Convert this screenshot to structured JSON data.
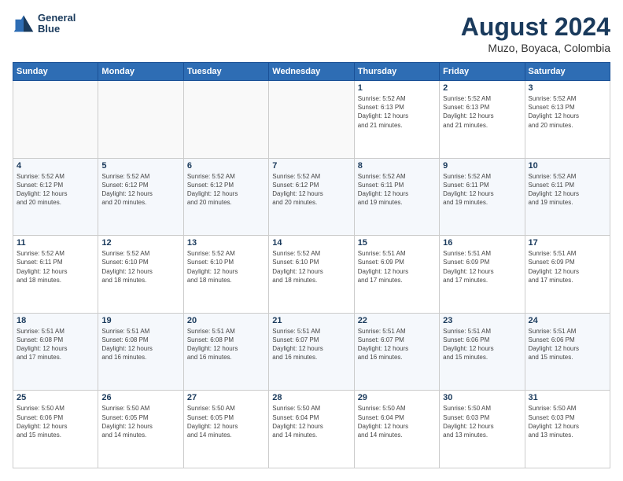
{
  "logo": {
    "line1": "General",
    "line2": "Blue"
  },
  "title": "August 2024",
  "subtitle": "Muzo, Boyaca, Colombia",
  "days_of_week": [
    "Sunday",
    "Monday",
    "Tuesday",
    "Wednesday",
    "Thursday",
    "Friday",
    "Saturday"
  ],
  "weeks": [
    [
      {
        "day": "",
        "info": ""
      },
      {
        "day": "",
        "info": ""
      },
      {
        "day": "",
        "info": ""
      },
      {
        "day": "",
        "info": ""
      },
      {
        "day": "1",
        "info": "Sunrise: 5:52 AM\nSunset: 6:13 PM\nDaylight: 12 hours\nand 21 minutes."
      },
      {
        "day": "2",
        "info": "Sunrise: 5:52 AM\nSunset: 6:13 PM\nDaylight: 12 hours\nand 21 minutes."
      },
      {
        "day": "3",
        "info": "Sunrise: 5:52 AM\nSunset: 6:13 PM\nDaylight: 12 hours\nand 20 minutes."
      }
    ],
    [
      {
        "day": "4",
        "info": "Sunrise: 5:52 AM\nSunset: 6:12 PM\nDaylight: 12 hours\nand 20 minutes."
      },
      {
        "day": "5",
        "info": "Sunrise: 5:52 AM\nSunset: 6:12 PM\nDaylight: 12 hours\nand 20 minutes."
      },
      {
        "day": "6",
        "info": "Sunrise: 5:52 AM\nSunset: 6:12 PM\nDaylight: 12 hours\nand 20 minutes."
      },
      {
        "day": "7",
        "info": "Sunrise: 5:52 AM\nSunset: 6:12 PM\nDaylight: 12 hours\nand 20 minutes."
      },
      {
        "day": "8",
        "info": "Sunrise: 5:52 AM\nSunset: 6:11 PM\nDaylight: 12 hours\nand 19 minutes."
      },
      {
        "day": "9",
        "info": "Sunrise: 5:52 AM\nSunset: 6:11 PM\nDaylight: 12 hours\nand 19 minutes."
      },
      {
        "day": "10",
        "info": "Sunrise: 5:52 AM\nSunset: 6:11 PM\nDaylight: 12 hours\nand 19 minutes."
      }
    ],
    [
      {
        "day": "11",
        "info": "Sunrise: 5:52 AM\nSunset: 6:11 PM\nDaylight: 12 hours\nand 18 minutes."
      },
      {
        "day": "12",
        "info": "Sunrise: 5:52 AM\nSunset: 6:10 PM\nDaylight: 12 hours\nand 18 minutes."
      },
      {
        "day": "13",
        "info": "Sunrise: 5:52 AM\nSunset: 6:10 PM\nDaylight: 12 hours\nand 18 minutes."
      },
      {
        "day": "14",
        "info": "Sunrise: 5:52 AM\nSunset: 6:10 PM\nDaylight: 12 hours\nand 18 minutes."
      },
      {
        "day": "15",
        "info": "Sunrise: 5:51 AM\nSunset: 6:09 PM\nDaylight: 12 hours\nand 17 minutes."
      },
      {
        "day": "16",
        "info": "Sunrise: 5:51 AM\nSunset: 6:09 PM\nDaylight: 12 hours\nand 17 minutes."
      },
      {
        "day": "17",
        "info": "Sunrise: 5:51 AM\nSunset: 6:09 PM\nDaylight: 12 hours\nand 17 minutes."
      }
    ],
    [
      {
        "day": "18",
        "info": "Sunrise: 5:51 AM\nSunset: 6:08 PM\nDaylight: 12 hours\nand 17 minutes."
      },
      {
        "day": "19",
        "info": "Sunrise: 5:51 AM\nSunset: 6:08 PM\nDaylight: 12 hours\nand 16 minutes."
      },
      {
        "day": "20",
        "info": "Sunrise: 5:51 AM\nSunset: 6:08 PM\nDaylight: 12 hours\nand 16 minutes."
      },
      {
        "day": "21",
        "info": "Sunrise: 5:51 AM\nSunset: 6:07 PM\nDaylight: 12 hours\nand 16 minutes."
      },
      {
        "day": "22",
        "info": "Sunrise: 5:51 AM\nSunset: 6:07 PM\nDaylight: 12 hours\nand 16 minutes."
      },
      {
        "day": "23",
        "info": "Sunrise: 5:51 AM\nSunset: 6:06 PM\nDaylight: 12 hours\nand 15 minutes."
      },
      {
        "day": "24",
        "info": "Sunrise: 5:51 AM\nSunset: 6:06 PM\nDaylight: 12 hours\nand 15 minutes."
      }
    ],
    [
      {
        "day": "25",
        "info": "Sunrise: 5:50 AM\nSunset: 6:06 PM\nDaylight: 12 hours\nand 15 minutes."
      },
      {
        "day": "26",
        "info": "Sunrise: 5:50 AM\nSunset: 6:05 PM\nDaylight: 12 hours\nand 14 minutes."
      },
      {
        "day": "27",
        "info": "Sunrise: 5:50 AM\nSunset: 6:05 PM\nDaylight: 12 hours\nand 14 minutes."
      },
      {
        "day": "28",
        "info": "Sunrise: 5:50 AM\nSunset: 6:04 PM\nDaylight: 12 hours\nand 14 minutes."
      },
      {
        "day": "29",
        "info": "Sunrise: 5:50 AM\nSunset: 6:04 PM\nDaylight: 12 hours\nand 14 minutes."
      },
      {
        "day": "30",
        "info": "Sunrise: 5:50 AM\nSunset: 6:03 PM\nDaylight: 12 hours\nand 13 minutes."
      },
      {
        "day": "31",
        "info": "Sunrise: 5:50 AM\nSunset: 6:03 PM\nDaylight: 12 hours\nand 13 minutes."
      }
    ]
  ]
}
